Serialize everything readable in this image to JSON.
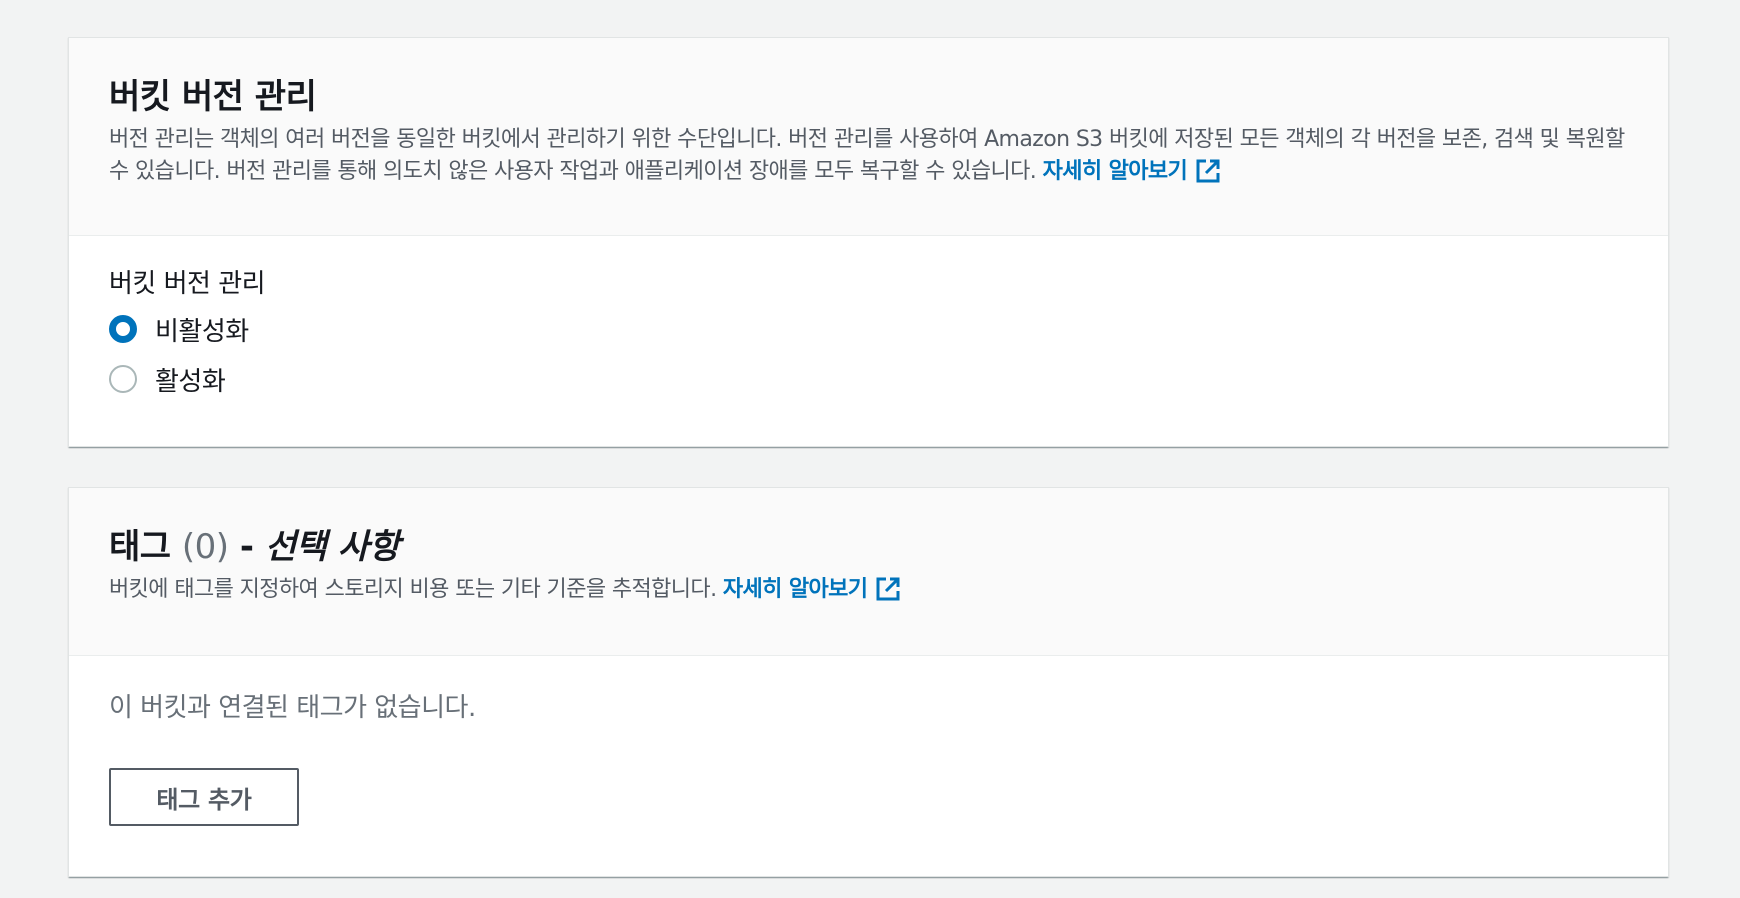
{
  "versioning": {
    "title": "버킷 버전 관리",
    "description": "버전 관리는 객체의 여러 버전을 동일한 버킷에서 관리하기 위한 수단입니다. 버전 관리를 사용하여 Amazon S3 버킷에 저장된 모든 객체의 각 버전을 보존, 검색 및 복원할 수 있습니다. 버전 관리를 통해 의도치 않은 사용자 작업과 애플리케이션 장애를 모두 복구할 수 있습니다.",
    "learn_more": "자세히 알아보기",
    "field_label": "버킷 버전 관리",
    "options": [
      {
        "label": "비활성화",
        "selected": true
      },
      {
        "label": "활성화",
        "selected": false
      }
    ]
  },
  "tags": {
    "title": "태그",
    "count": "(0)",
    "separator": "-",
    "optional": "선택 사항",
    "description": "버킷에 태그를 지정하여 스토리지 비용 또는 기타 기준을 추적합니다.",
    "learn_more": "자세히 알아보기",
    "empty_message": "이 버킷과 연결된 태그가 없습니다.",
    "add_button": "태그 추가"
  },
  "colors": {
    "link": "#0073bb",
    "radio_selected": "#0073bb",
    "page_background": "#f2f3f3",
    "header_background": "#fafafa"
  },
  "icons": {
    "external_link": "external-link-icon",
    "radio_selected": "radio-checked",
    "radio_unselected": "radio-unchecked"
  }
}
